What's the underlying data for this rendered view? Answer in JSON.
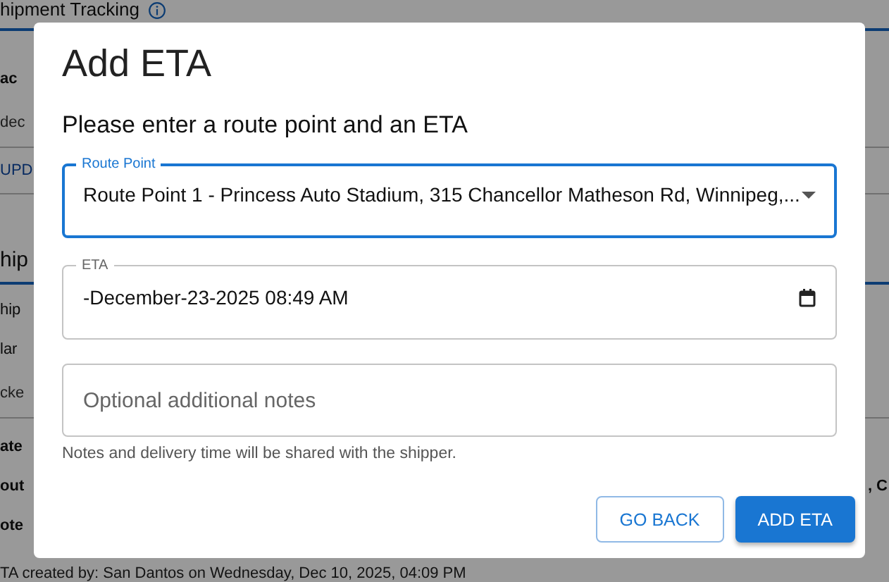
{
  "background": {
    "page_title": "hipment Tracking",
    "rows": [
      {
        "kind": "bold",
        "text": "ac"
      },
      {
        "kind": "muted",
        "text": "dec"
      },
      {
        "kind": "link",
        "text": "UPD"
      },
      {
        "kind": "heading",
        "text": "hip"
      },
      {
        "kind": "plain",
        "text": "hip"
      },
      {
        "kind": "plain",
        "text": "lar"
      },
      {
        "kind": "muted",
        "text": "cke"
      },
      {
        "kind": "bold",
        "text": "ate"
      },
      {
        "kind": "bold",
        "text": "out",
        "right_text": ", C"
      },
      {
        "kind": "bold",
        "text": "ote"
      }
    ],
    "footer_note": "TA created by: San Dantos on Wednesday, Dec 10, 2025, 04:09 PM"
  },
  "dialog": {
    "title": "Add ETA",
    "prompt": "Please enter a route point and an ETA",
    "fields": [
      {
        "kind": "select",
        "label": "Route Point",
        "value": "Route Point 1 - Princess Auto Stadium, 315 Chancellor Matheson Rd, Winnipeg,...",
        "focused": true
      },
      {
        "kind": "datetime",
        "label": "ETA",
        "value": "-December-23-2025 08:49 AM",
        "focused": false
      },
      {
        "kind": "text",
        "placeholder": "Optional additional notes",
        "focused": false
      }
    ],
    "helper": "Notes and delivery time will be shared with the shipper.",
    "buttons": [
      {
        "label": "GO BACK",
        "kind": "outlined"
      },
      {
        "label": "ADD ETA",
        "kind": "contained"
      }
    ]
  }
}
